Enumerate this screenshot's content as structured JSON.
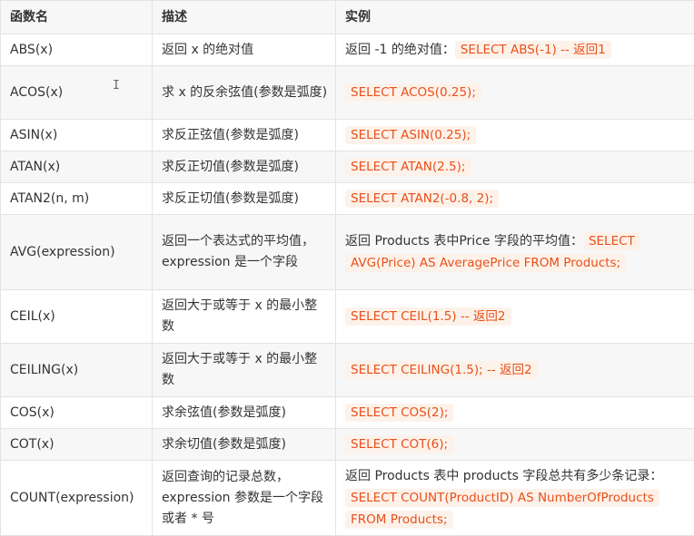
{
  "headers": {
    "name": "函数名",
    "desc": "描述",
    "example": "实例"
  },
  "rows": [
    {
      "name": "ABS(x)",
      "desc": "返回 x 的绝对值",
      "prefix": "返回 -1 的绝对值：",
      "code": "SELECT ABS(-1) -- 返回1"
    },
    {
      "name": "ACOS(x)",
      "desc": "求 x 的反余弦值(参数是弧度)",
      "prefix": "",
      "code": "SELECT ACOS(0.25);"
    },
    {
      "name": "ASIN(x)",
      "desc": "求反正弦值(参数是弧度)",
      "prefix": "",
      "code": "SELECT ASIN(0.25);"
    },
    {
      "name": "ATAN(x)",
      "desc": "求反正切值(参数是弧度)",
      "prefix": "",
      "code": "SELECT ATAN(2.5);"
    },
    {
      "name": "ATAN2(n, m)",
      "desc": "求反正切值(参数是弧度)",
      "prefix": "",
      "code": "SELECT ATAN2(-0.8, 2);"
    },
    {
      "name": "AVG(expression)",
      "desc": "返回一个表达式的平均值，expression 是一个字段",
      "prefix": "返回 Products 表中Price 字段的平均值：",
      "code": "SELECT AVG(Price) AS AveragePrice FROM Products;"
    },
    {
      "name": "CEIL(x)",
      "desc": "返回大于或等于 x 的最小整数",
      "prefix": "",
      "code": "SELECT CEIL(1.5) -- 返回2"
    },
    {
      "name": "CEILING(x)",
      "desc": "返回大于或等于 x 的最小整数",
      "prefix": "",
      "code": "SELECT CEILING(1.5); -- 返回2"
    },
    {
      "name": "COS(x)",
      "desc": "求余弦值(参数是弧度)",
      "prefix": "",
      "code": "SELECT COS(2);"
    },
    {
      "name": "COT(x)",
      "desc": "求余切值(参数是弧度)",
      "prefix": "",
      "code": "SELECT COT(6);"
    },
    {
      "name": "COUNT(expression)",
      "desc": "返回查询的记录总数，expression 参数是一个字段或者 * 号",
      "prefix": "返回 Products 表中 products 字段总共有多少条记录：",
      "code": "SELECT COUNT(ProductID) AS NumberOfProducts FROM Products;"
    }
  ],
  "cursor_glyph": "I"
}
